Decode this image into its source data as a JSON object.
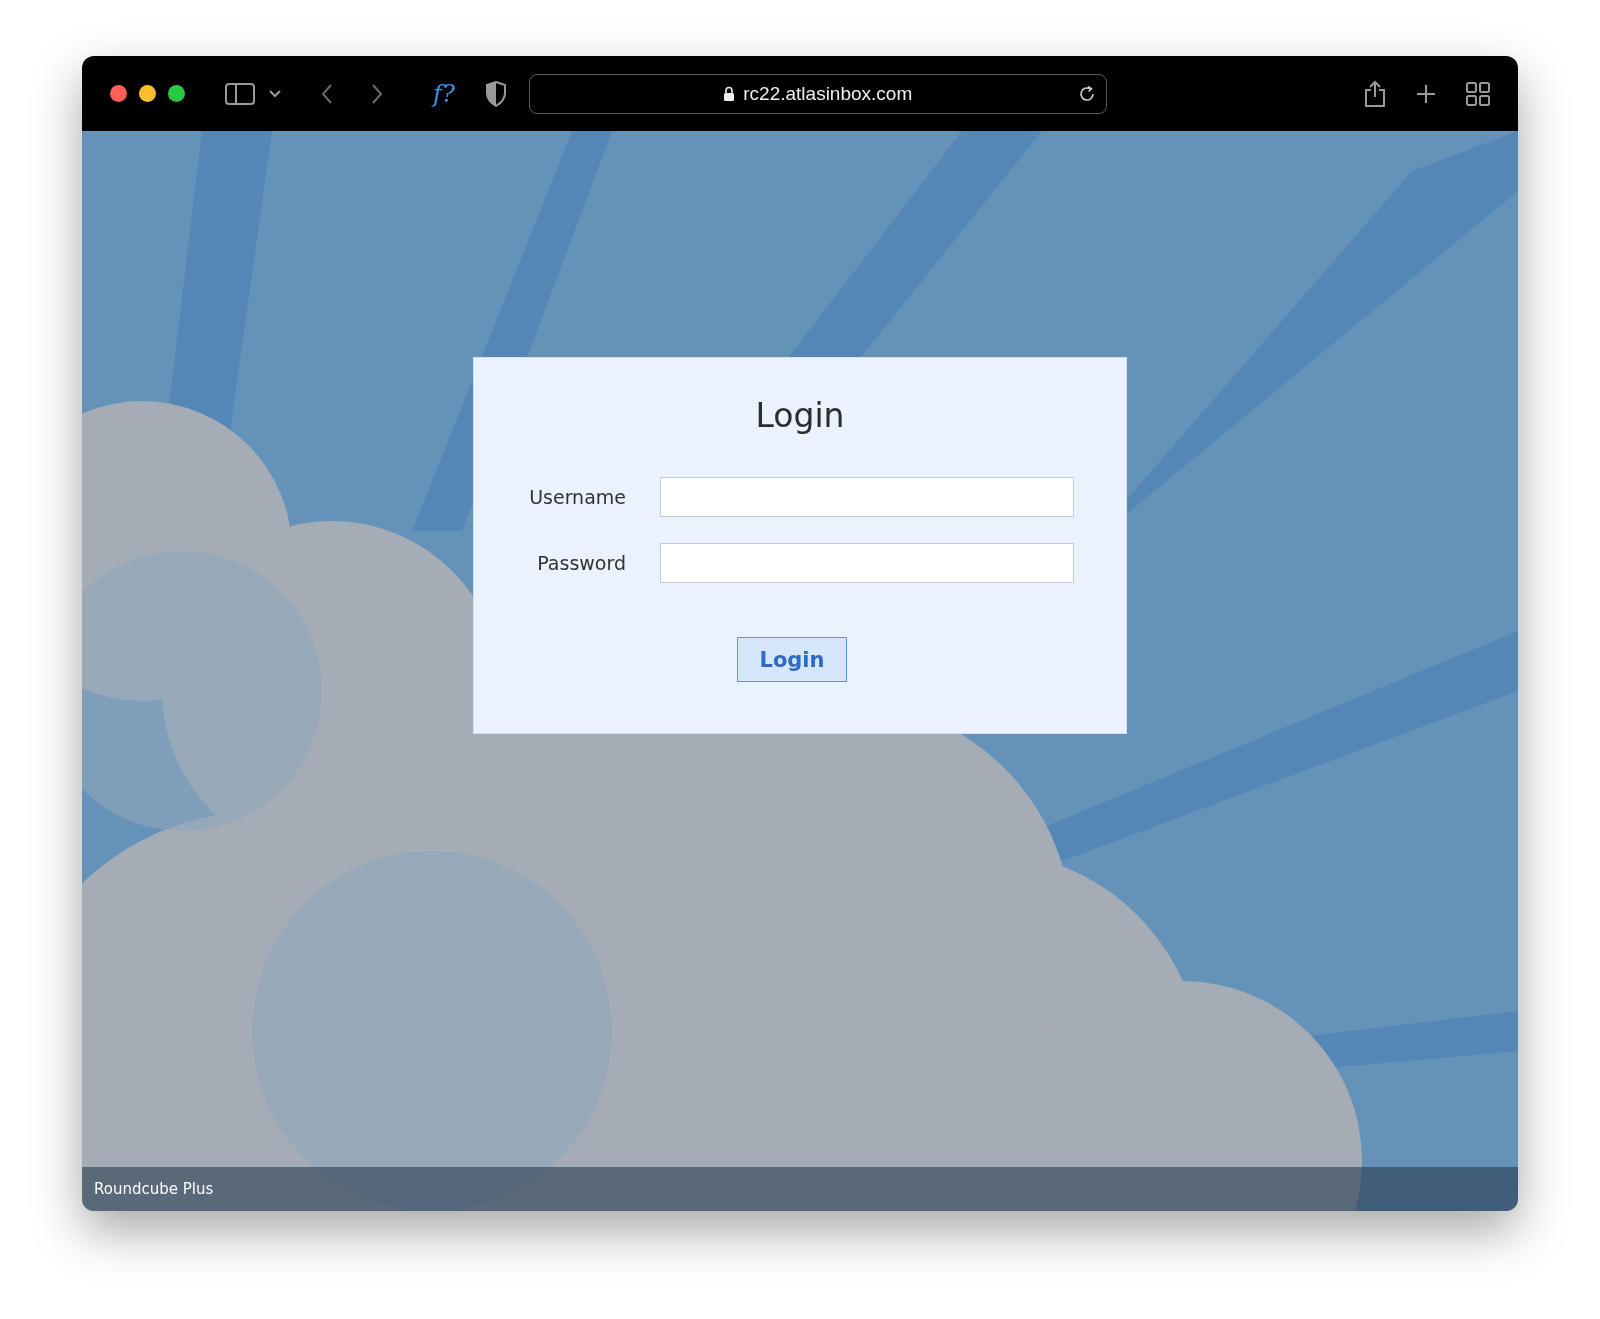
{
  "browser": {
    "url": "rc22.atlasinbox.com",
    "extension_label": "f?"
  },
  "login": {
    "title": "Login",
    "fields": [
      {
        "label": "Username"
      },
      {
        "label": "Password"
      }
    ],
    "button": "Login"
  },
  "footer": {
    "text": "Roundcube Plus"
  }
}
